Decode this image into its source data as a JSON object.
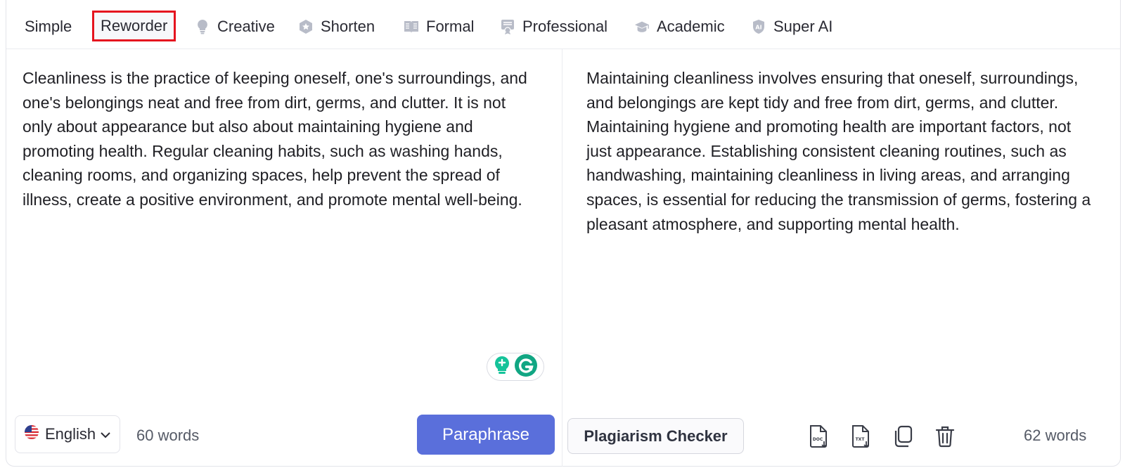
{
  "tabs": [
    {
      "label": "Simple",
      "icon": ""
    },
    {
      "label": "Reworder",
      "icon": "",
      "active": true
    },
    {
      "label": "Creative",
      "icon": "lightbulb-icon"
    },
    {
      "label": "Shorten",
      "icon": "hexagon-star-icon"
    },
    {
      "label": "Formal",
      "icon": "book-icon"
    },
    {
      "label": "Professional",
      "icon": "certificate-icon"
    },
    {
      "label": "Academic",
      "icon": "graduation-cap-icon"
    },
    {
      "label": "Super AI",
      "icon": "ai-shield-icon"
    }
  ],
  "input": {
    "text": "Cleanliness is the practice of keeping oneself, one's surroundings, and one's belongings neat and free from dirt, germs, and clutter. It is not only about appearance but also about maintaining hygiene and promoting health. Regular cleaning habits, such as washing hands, cleaning rooms, and organizing spaces, help prevent the spread of illness, create a positive environment, and promote mental well-being.",
    "word_count": "60 words",
    "language": "English",
    "language_icon": "us-flag-icon"
  },
  "output": {
    "text": "Maintaining cleanliness involves ensuring that oneself, surroundings, and belongings are kept tidy and free from dirt, germs, and clutter. Maintaining hygiene and promoting health are important factors, not just appearance. Establishing consistent cleaning routines, such as handwashing, maintaining cleanliness in living areas, and arranging spaces, is essential for reducing the transmission of germs, fostering a pleasant atmosphere, and supporting mental health.",
    "word_count": "62 words"
  },
  "buttons": {
    "paraphrase": "Paraphrase",
    "plagiarism_checker": "Plagiarism Checker"
  },
  "toolbar_icons": [
    "doc-download-icon",
    "txt-download-icon",
    "copy-icon",
    "trash-icon"
  ],
  "colors": {
    "accent": "#5a6fdb",
    "active_tab_border": "#e5141f",
    "grammarly_green": "#15c39a",
    "grammarly_dark": "#11a683"
  }
}
